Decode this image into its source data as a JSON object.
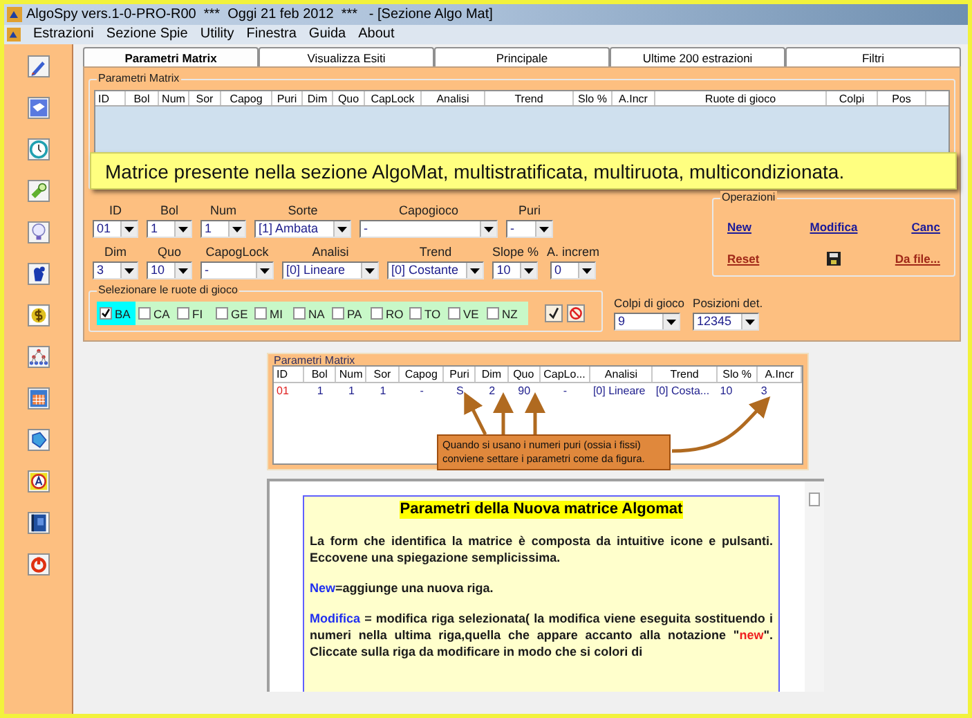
{
  "window": {
    "title": "AlgoSpy vers.1-0-PRO-R00  ***  Oggi 21 feb 2012  ***   - [Sezione Algo Mat]"
  },
  "menu": [
    "Estrazioni",
    "Sezione Spie",
    "Utility",
    "Finestra",
    "Guida",
    "About"
  ],
  "tabs": [
    {
      "label": "Parametri Matrix",
      "selected": true
    },
    {
      "label": "Visualizza Esiti",
      "selected": false
    },
    {
      "label": "Principale",
      "selected": false
    },
    {
      "label": "Ultime 200 estrazioni",
      "selected": false
    },
    {
      "label": "Filtri",
      "selected": false
    }
  ],
  "matrix": {
    "title": "Parametri Matrix",
    "columns": [
      "ID",
      "Bol",
      "Num",
      "Sor",
      "Capog",
      "Puri",
      "Dim",
      "Quo",
      "CapLock",
      "Analisi",
      "Trend",
      "Slo %",
      "A.Incr",
      "Ruote di gioco",
      "Colpi",
      "Pos"
    ],
    "callout": "Matrice presente nella sezione AlgoMat, multistratificata, multiruota, multicondizionata."
  },
  "form_row_1": [
    {
      "label": "ID",
      "value": "01"
    },
    {
      "label": "Bol",
      "value": "1"
    },
    {
      "label": "Num",
      "value": "1"
    },
    {
      "label": "Sorte",
      "value": "[1] Ambata"
    },
    {
      "label": "Capogioco",
      "value": "-"
    },
    {
      "label": "Puri",
      "value": "-"
    }
  ],
  "form_row_2": [
    {
      "label": "Dim",
      "value": "3"
    },
    {
      "label": "Quo",
      "value": "10"
    },
    {
      "label": "CapogLock",
      "value": "-"
    },
    {
      "label": "Analisi",
      "value": "[0] Lineare"
    },
    {
      "label": "Trend",
      "value": "[0] Costante"
    },
    {
      "label": "Slope %",
      "value": "10"
    },
    {
      "label": "A. increm",
      "value": "0"
    }
  ],
  "wheels": {
    "title": "Selezionare le ruote di gioco",
    "items": [
      {
        "label": "BA",
        "checked": true
      },
      {
        "label": "CA",
        "checked": false
      },
      {
        "label": "FI",
        "checked": false
      },
      {
        "label": "GE",
        "checked": false
      },
      {
        "label": "MI",
        "checked": false
      },
      {
        "label": "NA",
        "checked": false
      },
      {
        "label": "PA",
        "checked": false
      },
      {
        "label": "RO",
        "checked": false
      },
      {
        "label": "TO",
        "checked": false
      },
      {
        "label": "VE",
        "checked": false
      },
      {
        "label": "NZ",
        "checked": false
      }
    ]
  },
  "colpi": {
    "label": "Colpi di gioco",
    "value": "9"
  },
  "posizioni": {
    "label": "Posizioni det.",
    "value": "12345"
  },
  "operations": {
    "title": "Operazioni",
    "items": [
      {
        "label": "New",
        "kind": "link"
      },
      {
        "label": "Modifica",
        "kind": "link"
      },
      {
        "label": "Canc",
        "kind": "link"
      },
      {
        "label": "Reset",
        "kind": "danger"
      },
      {
        "kind": "save"
      },
      {
        "label": "Da file...",
        "kind": "danger"
      }
    ]
  },
  "example": {
    "title": "Parametri Matrix",
    "columns": [
      "ID",
      "Bol",
      "Num",
      "Sor",
      "Capog",
      "Puri",
      "Dim",
      "Quo",
      "CapLo...",
      "Analisi",
      "Trend",
      "Slo %",
      "A.Incr"
    ],
    "rows": [
      [
        "01",
        "1",
        "1",
        "1",
        "-",
        "S",
        "2",
        "90",
        "-",
        "[0] Lineare",
        "[0] Costa...",
        "10",
        "3"
      ]
    ],
    "note": "Quando si usano i numeri puri (ossia i fissi) conviene settare i parametri come da figura."
  },
  "doc": {
    "heading": "Parametri della Nuova matrice Algomat",
    "paragraphs": [
      [
        {
          "text": "La form che identifica la matrice è composta da intuitive icone e pulsanti. Eccovene una spiegazione semplicissima.",
          "kind": "plain"
        }
      ],
      [
        {
          "text": "New",
          "kind": "keyword"
        },
        {
          "text": "=aggiunge una nuova riga.",
          "kind": "plain"
        }
      ],
      [
        {
          "text": "Modifica",
          "kind": "keyword"
        },
        {
          "text": " = modifica riga selezionata( la modifica viene eseguita sostituendo i numeri nella ultima riga,quella che appare accanto alla notazione \"",
          "kind": "plain"
        },
        {
          "text": "new",
          "kind": "highlight"
        },
        {
          "text": "\". Cliccate sulla riga da modificare in modo che si colori di",
          "kind": "plain"
        }
      ]
    ]
  }
}
